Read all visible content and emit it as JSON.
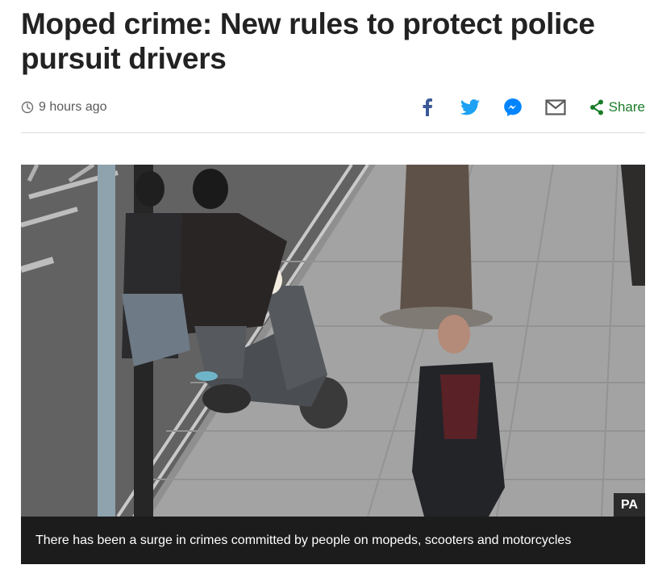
{
  "article": {
    "headline": "Moped crime: New rules to protect police pursuit drivers",
    "timestamp": "9 hours ago"
  },
  "share": {
    "icons": [
      "facebook-icon",
      "twitter-icon",
      "messenger-icon",
      "email-icon",
      "share-icon"
    ],
    "share_label": "Share"
  },
  "image": {
    "credit": "PA",
    "caption": "There has been a surge in crimes committed by people on mopeds, scooters and motorcycles"
  },
  "colors": {
    "headline": "#222222",
    "facebook": "#3b5998",
    "twitter": "#1da1f2",
    "messenger": "#0084ff",
    "share_green": "#1a7d28",
    "caption_bg": "#1c1c1c"
  }
}
